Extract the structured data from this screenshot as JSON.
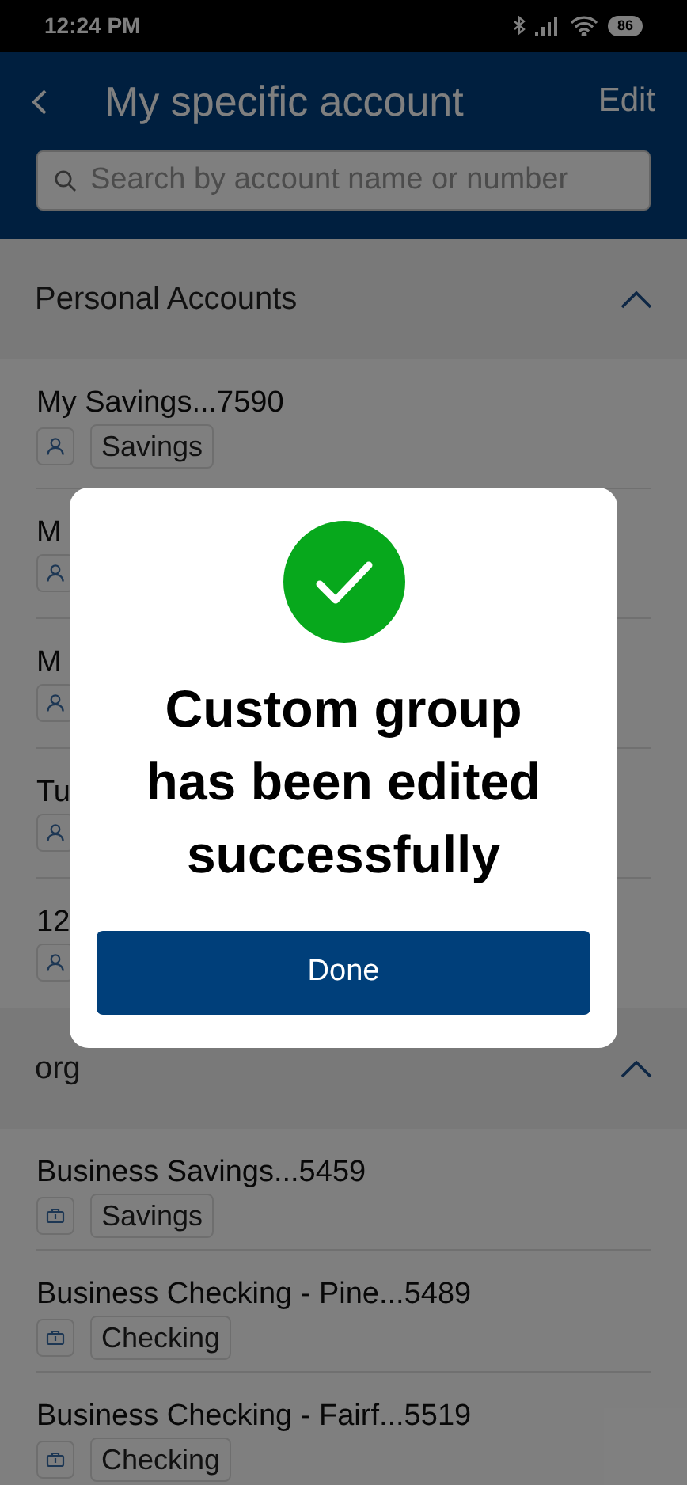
{
  "status_bar": {
    "time": "12:24 PM",
    "battery": "86"
  },
  "header": {
    "title": "My specific account",
    "action": "Edit"
  },
  "search": {
    "placeholder": "Search by account name or number"
  },
  "groups": [
    {
      "title": "Personal Accounts",
      "expanded": true,
      "accounts": [
        {
          "name": "My Savings...7590",
          "type": "Savings",
          "kind": "personal"
        },
        {
          "name": "M",
          "kind": "personal"
        },
        {
          "name": "M",
          "kind": "personal"
        },
        {
          "name": "Tu",
          "kind": "personal"
        },
        {
          "name": "12",
          "kind": "personal"
        }
      ]
    },
    {
      "title": "org",
      "expanded": true,
      "accounts": [
        {
          "name": "Business Savings...5459",
          "type": "Savings",
          "kind": "business"
        },
        {
          "name": "Business Checking - Pine...5489",
          "type": "Checking",
          "kind": "business"
        },
        {
          "name": "Business Checking - Fairf...5519",
          "type": "Checking",
          "kind": "business"
        }
      ]
    }
  ],
  "dialog": {
    "message": "Custom group has been edited successfully",
    "button": "Done"
  }
}
